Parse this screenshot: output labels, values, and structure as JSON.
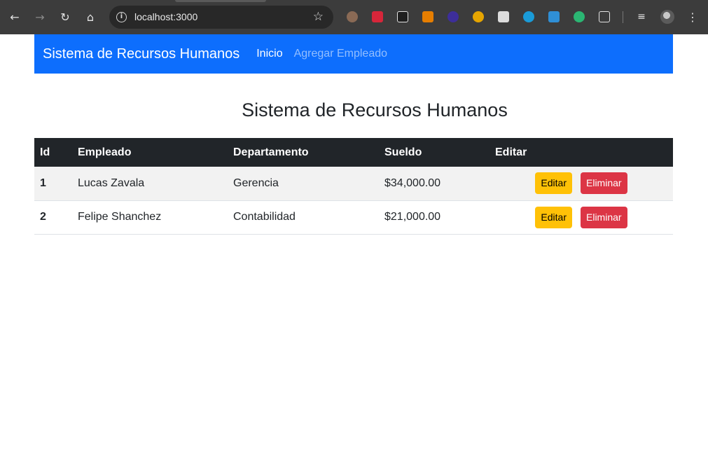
{
  "browser": {
    "url": "localhost:3000"
  },
  "navbar": {
    "brand": "Sistema de Recursos Humanos",
    "links": [
      {
        "label": "Inicio"
      },
      {
        "label": "Agregar Empleado"
      }
    ],
    "bg_color": "#0d6efd"
  },
  "main": {
    "title": "Sistema de Recursos Humanos",
    "table": {
      "headers": [
        "Id",
        "Empleado",
        "Departamento",
        "Sueldo",
        "Editar"
      ],
      "rows": [
        {
          "id": "1",
          "empleado": "Lucas Zavala",
          "departamento": "Gerencia",
          "sueldo": "$34,000.00"
        },
        {
          "id": "2",
          "empleado": "Felipe Shanchez",
          "departamento": "Contabilidad",
          "sueldo": "$21,000.00"
        }
      ],
      "edit_label": "Editar",
      "delete_label": "Eliminar"
    }
  },
  "colors": {
    "header_bg": "#212529",
    "edit_button": "#ffc107",
    "delete_button": "#dc3545"
  }
}
